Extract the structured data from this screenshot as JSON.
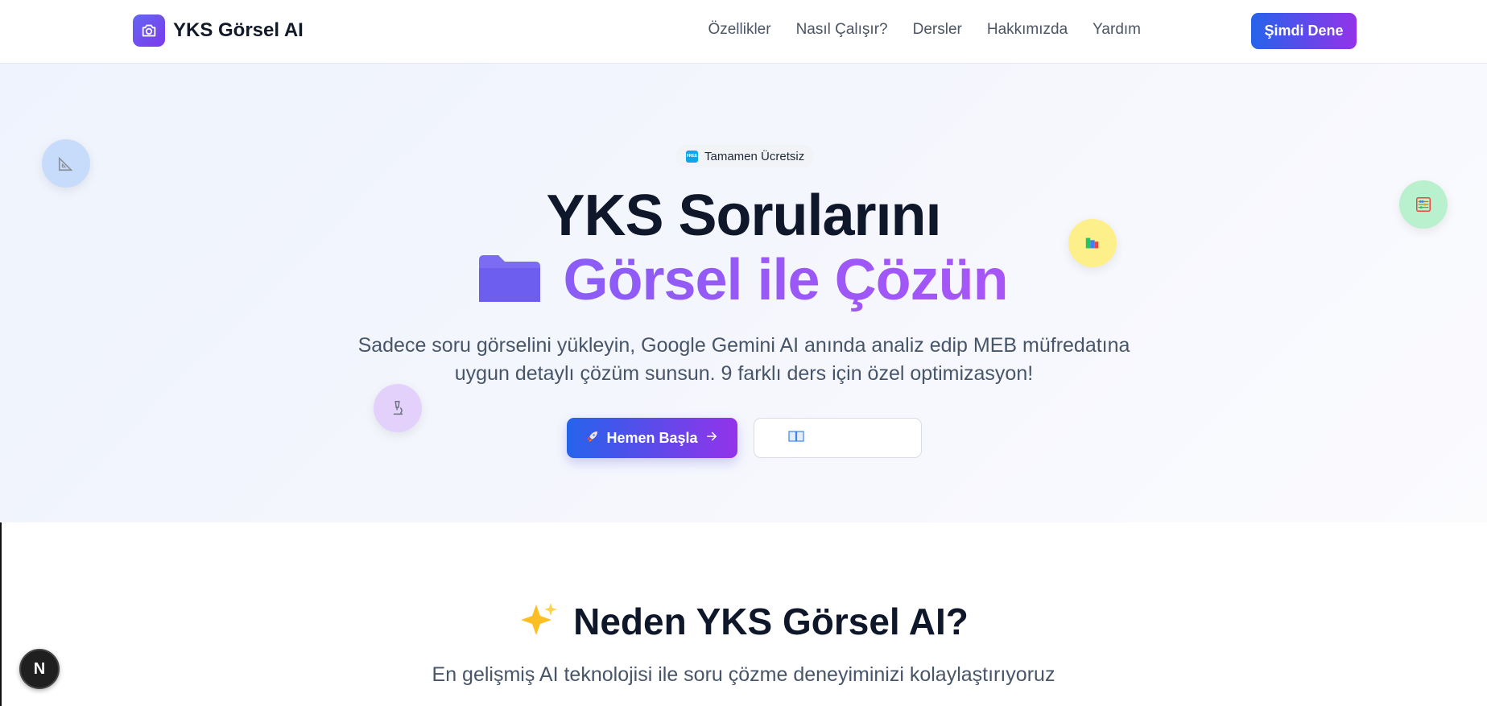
{
  "header": {
    "brand_name": "YKS Görsel AI",
    "nav": [
      "Özellikler",
      "Nasıl Çalışır?",
      "Dersler",
      "Hakkımızda",
      "Yardım"
    ],
    "cta_label": "Şimdi Dene"
  },
  "hero": {
    "badge_text": "Tamamen Ücretsiz",
    "badge_icon_text": "FREE",
    "title_line1": "YKS Sorularını",
    "title_line2": "Görsel ile Çözün",
    "subtitle": "Sadece soru görselini yükleyin, Google Gemini AI anında analiz edip MEB müfredatına uygun detaylı çözüm sunsun. 9 farklı ders için özel optimizasyon!",
    "primary_button": "Hemen Başla",
    "secondary_button_icon": "book-icon",
    "floating_icons": [
      "triangle-ruler-icon",
      "books-icon",
      "abacus-icon",
      "microscope-icon"
    ]
  },
  "features": {
    "title": "Neden YKS Görsel AI?",
    "subtitle": "En gelişmiş AI teknolojisi ile soru çözme deneyiminizi kolaylaştırıyoruz"
  },
  "dev_badge": {
    "letter": "N"
  },
  "colors": {
    "accent_start": "#2563eb",
    "accent_end": "#9333ea",
    "title_purple": "#8b5cf6"
  }
}
